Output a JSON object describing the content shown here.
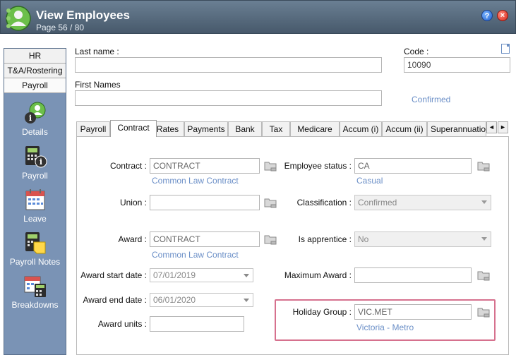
{
  "window": {
    "title": "View Employees",
    "subtitle": "Page 56 / 80",
    "help_symbol": "?",
    "close_symbol": "×"
  },
  "nav": {
    "tabs": [
      "HR",
      "T&A/Rostering",
      "Payroll"
    ],
    "items": [
      {
        "label": "Details",
        "icon": "person-info-icon"
      },
      {
        "label": "Payroll",
        "icon": "calculator-info-icon"
      },
      {
        "label": "Leave",
        "icon": "calendar-icon"
      },
      {
        "label": "Payroll Notes",
        "icon": "calculator-note-icon"
      },
      {
        "label": "Breakdowns",
        "icon": "calendar-calculator-icon"
      }
    ]
  },
  "header": {
    "last_name_label": "Last name :",
    "last_name_value": "",
    "code_label": "Code :",
    "code_value": "10090",
    "first_names_label": "First Names",
    "first_names_value": "",
    "status_link": "Confirmed"
  },
  "tabs": [
    "Payroll",
    "Contract",
    "Rates",
    "Payments",
    "Bank",
    "Tax",
    "Medicare",
    "Accum (i)",
    "Accum (ii)",
    "Superannuation"
  ],
  "active_tab": "Contract",
  "tab_scroll": {
    "left": "◄",
    "right": "►"
  },
  "contract": {
    "contract_label": "Contract :",
    "contract_value": "CONTRACT",
    "contract_link": "Common Law Contract",
    "union_label": "Union :",
    "union_value": "",
    "award_label": "Award :",
    "award_value": "CONTRACT",
    "award_link": "Common Law Contract",
    "award_start_label": "Award start date :",
    "award_start_value": "07/01/2019",
    "award_end_label": "Award end date :",
    "award_end_value": "06/01/2020",
    "award_units_label": "Award units :",
    "award_units_value": "",
    "employee_status_label": "Employee status :",
    "employee_status_value": "CA",
    "employee_status_link": "Casual",
    "classification_label": "Classification :",
    "classification_value": "Confirmed",
    "apprentice_label": "Is apprentice :",
    "apprentice_value": "No",
    "max_award_label": "Maximum Award :",
    "max_award_value": "",
    "holiday_group_label": "Holiday Group :",
    "holiday_group_value": "VIC.MET",
    "holiday_group_link": "Victoria - Metro"
  },
  "colors": {
    "titlebar": "#54687c",
    "nav": "#7a93b5",
    "link": "#6b8fc7",
    "highlight": "#d6718e"
  }
}
